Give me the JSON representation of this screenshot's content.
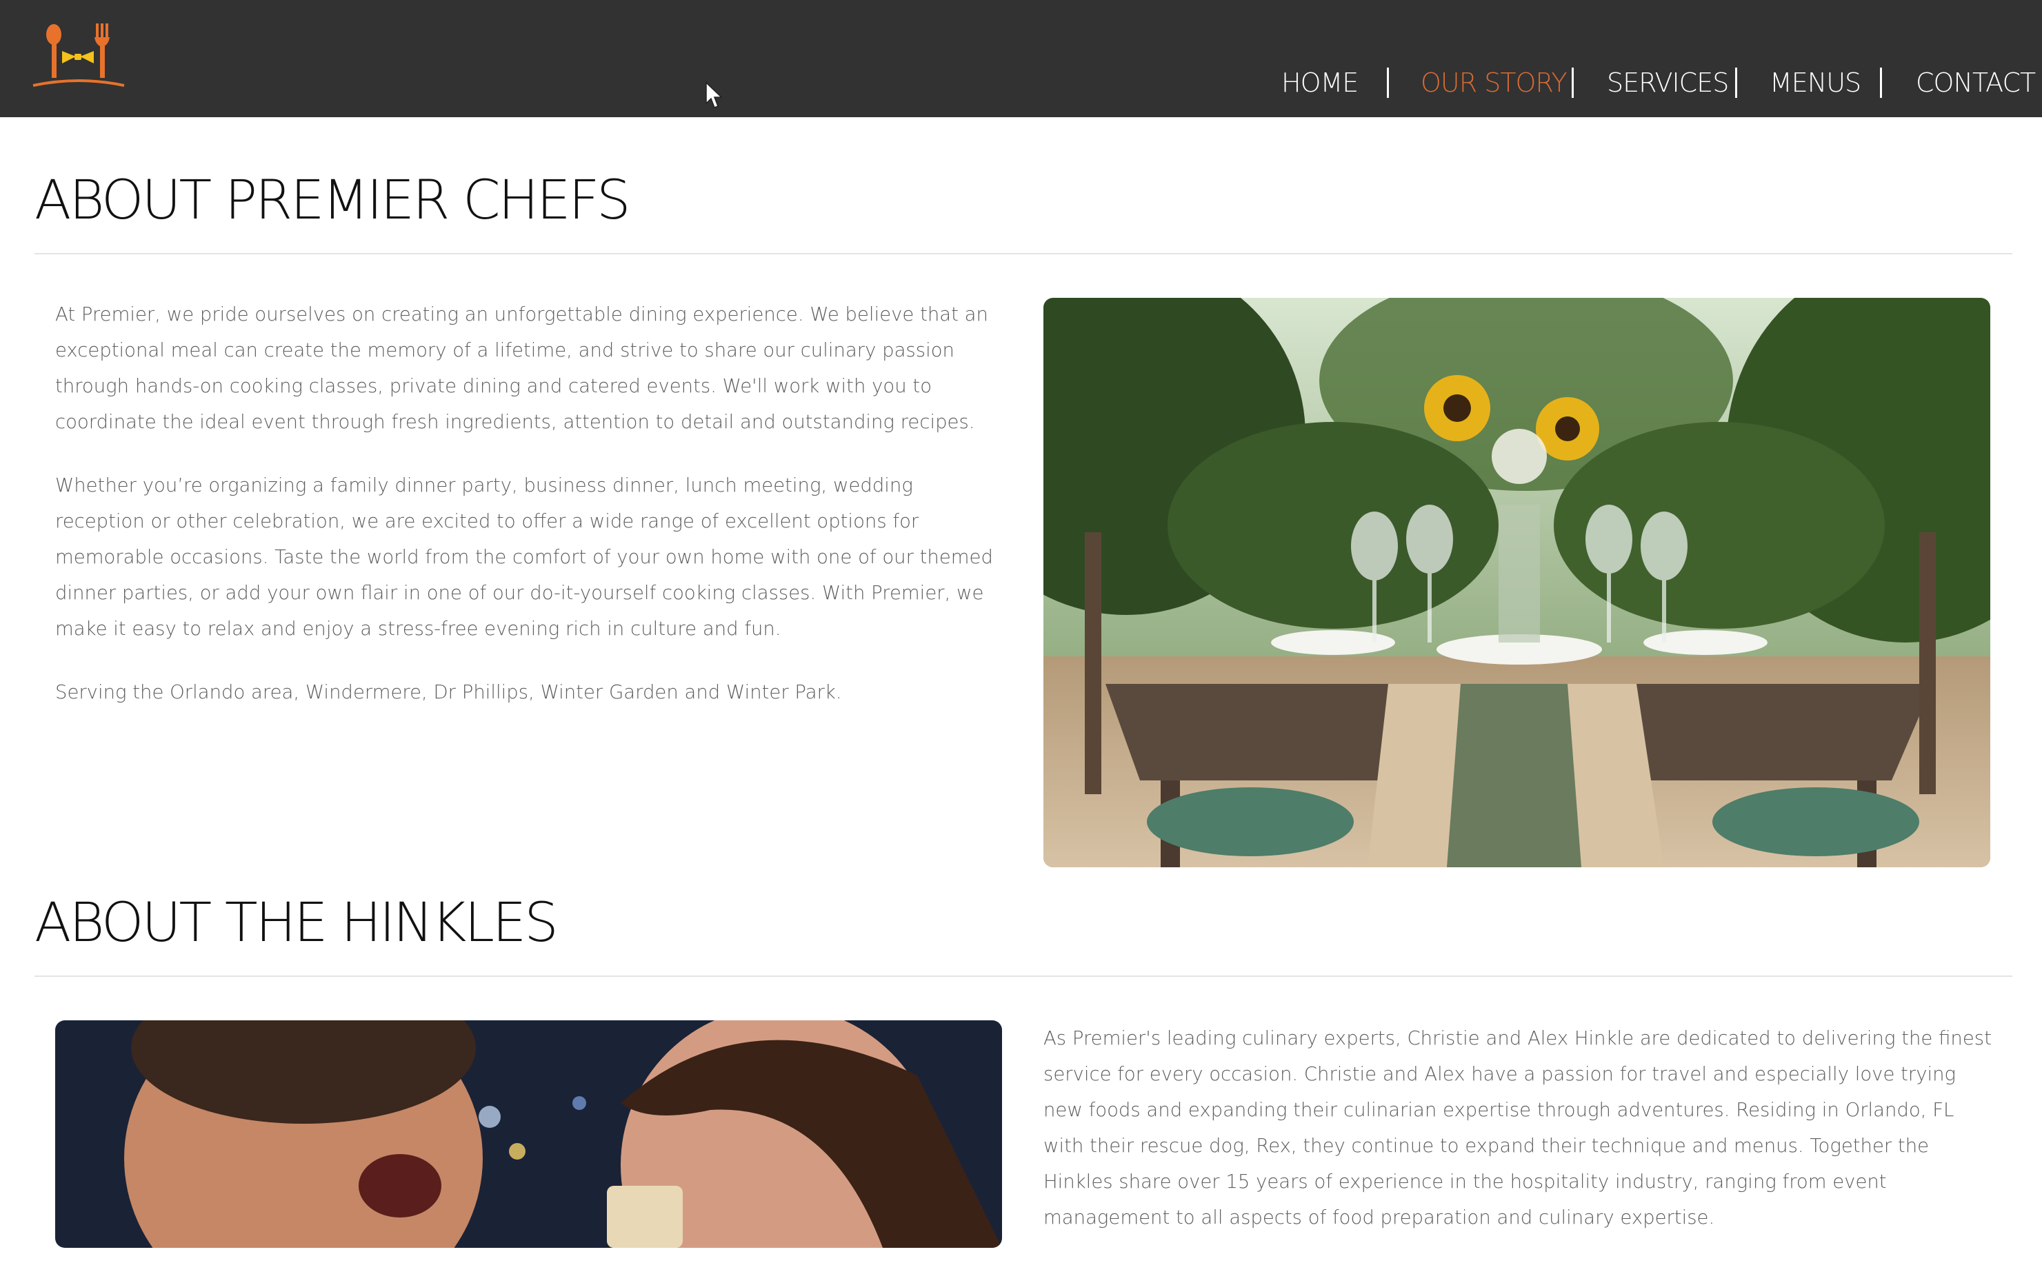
{
  "header": {
    "logo_alt": "Premier Chefs logo",
    "nav": [
      {
        "label": "HOME",
        "active": false
      },
      {
        "label": "OUR STORY",
        "active": true
      },
      {
        "label": "SERVICES",
        "active": false
      },
      {
        "label": "MENUS",
        "active": false
      },
      {
        "label": "CONTACT",
        "active": false
      }
    ],
    "colors": {
      "bar": "#323232",
      "active": "#d86a33",
      "logo_orange": "#e8722c",
      "logo_gold": "#f4c21a"
    }
  },
  "about_premier": {
    "title": "ABOUT PREMIER CHEFS",
    "paragraphs": [
      "At Premier, we pride ourselves on creating an unforgettable dining experience. We believe that an exceptional meal can create the memory of a lifetime, and strive to share our culinary passion through hands-on cooking classes, private dining and catered events. We'll work with you to coordinate the ideal event through fresh ingredients, attention to detail and outstanding recipes.",
      "Whether you’re organizing a family dinner party, business dinner, lunch meeting, wedding reception or other celebration, we are excited to offer a wide range of excellent options for memorable occasions. Taste the world from the comfort of your own home with one of our themed dinner parties, or add your own flair in one of our do-it-yourself cooking classes. With Premier, we make it easy to relax and enjoy a stress-free evening rich in culture and fun.",
      "Serving the Orlando area, Windermere, Dr Phillips, Winter Garden and Winter Park."
    ],
    "image_icon": "outdoor-table-sunflowers-photo"
  },
  "about_hinkles": {
    "title": "ABOUT THE HINKLES",
    "paragraphs": [
      "As Premier's leading culinary experts, Christie and Alex Hinkle are dedicated to delivering the finest service for every occasion. Christie and Alex have a passion for travel and especially love trying new foods and expanding their culinarian expertise through adventures. Residing in Orlando, FL with their rescue dog, Rex, they continue to expand their technique and menus. Together the Hinkles share over 15 years of experience in the hospitality industry, ranging from event management to all aspects of food preparation and culinary expertise."
    ],
    "image_icon": "couple-wedding-cake-photo"
  }
}
